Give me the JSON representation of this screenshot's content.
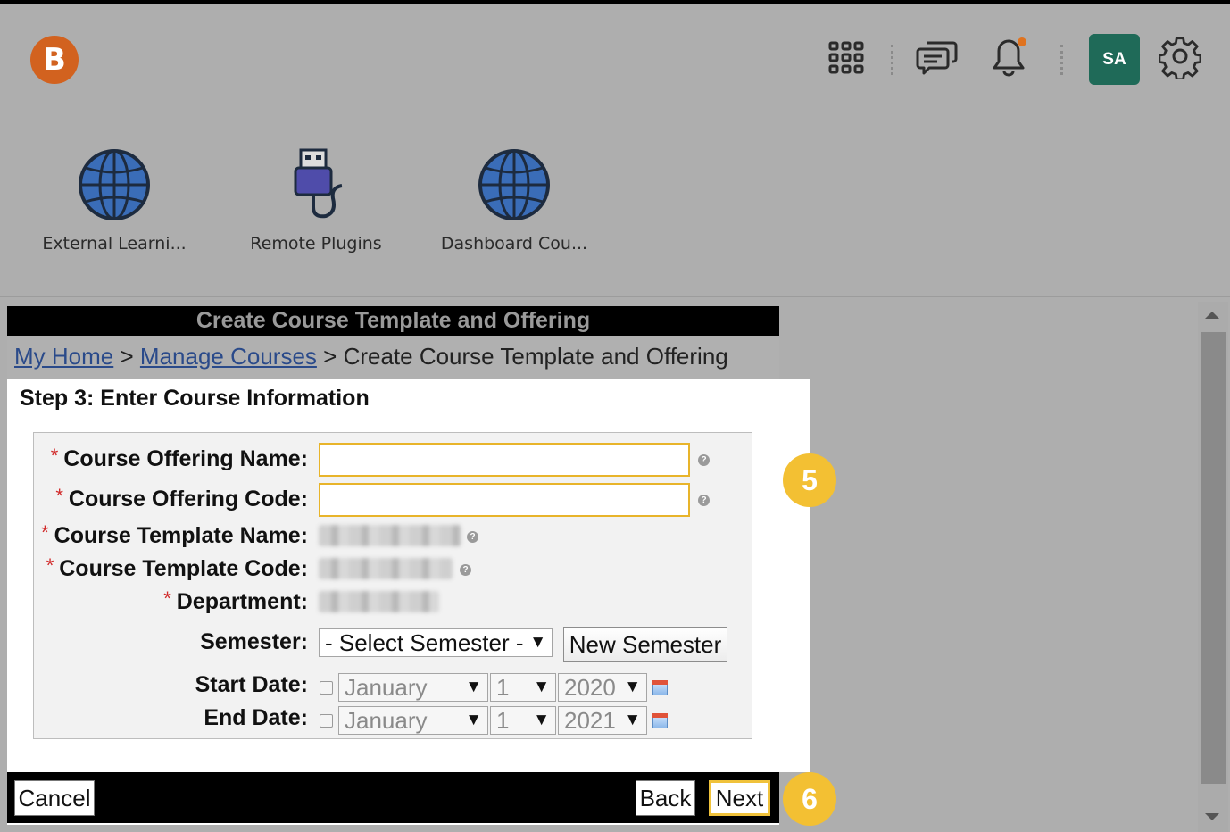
{
  "header": {
    "logo_text": "B",
    "avatar_initials": "SA",
    "icons": [
      "apps-grid-icon",
      "messages-icon",
      "notifications-bell-icon",
      "settings-gear-icon"
    ],
    "colors": {
      "logo": "#d2621f",
      "avatar": "#1f6a58",
      "notification_dot": "#e0731f"
    }
  },
  "tools": [
    {
      "label": "External Learni...",
      "icon": "globe-icon"
    },
    {
      "label": "Remote Plugins",
      "icon": "usb-plug-icon"
    },
    {
      "label": "Dashboard Cou...",
      "icon": "globe-icon"
    }
  ],
  "dialog": {
    "title": "Create Course Template and Offering",
    "breadcrumb": {
      "home": "My Home",
      "sep": ">",
      "manage": "Manage Courses",
      "current": "Create Course Template and Offering"
    },
    "step_heading": "Step 3: Enter Course Information",
    "fields": {
      "offering_name": {
        "label": "Course Offering Name:",
        "value": ""
      },
      "offering_code": {
        "label": "Course Offering Code:",
        "value": ""
      },
      "template_name": {
        "label": "Course Template Name:"
      },
      "template_code": {
        "label": "Course Template Code:"
      },
      "department": {
        "label": "Department:"
      },
      "semester": {
        "label": "Semester:",
        "selected": "- Select Semester -",
        "new_button": "New Semester"
      },
      "start_date": {
        "label": "Start Date:",
        "month": "January",
        "day": "1",
        "year": "2020"
      },
      "end_date": {
        "label": "End Date:",
        "month": "January",
        "day": "1",
        "year": "2021"
      }
    },
    "required_mark": "*",
    "help_mark": "?",
    "arrow": "▼",
    "buttons": {
      "cancel": "Cancel",
      "back": "Back",
      "next": "Next"
    }
  },
  "callouts": {
    "five": "5",
    "six": "6",
    "color": "#f3c033"
  }
}
